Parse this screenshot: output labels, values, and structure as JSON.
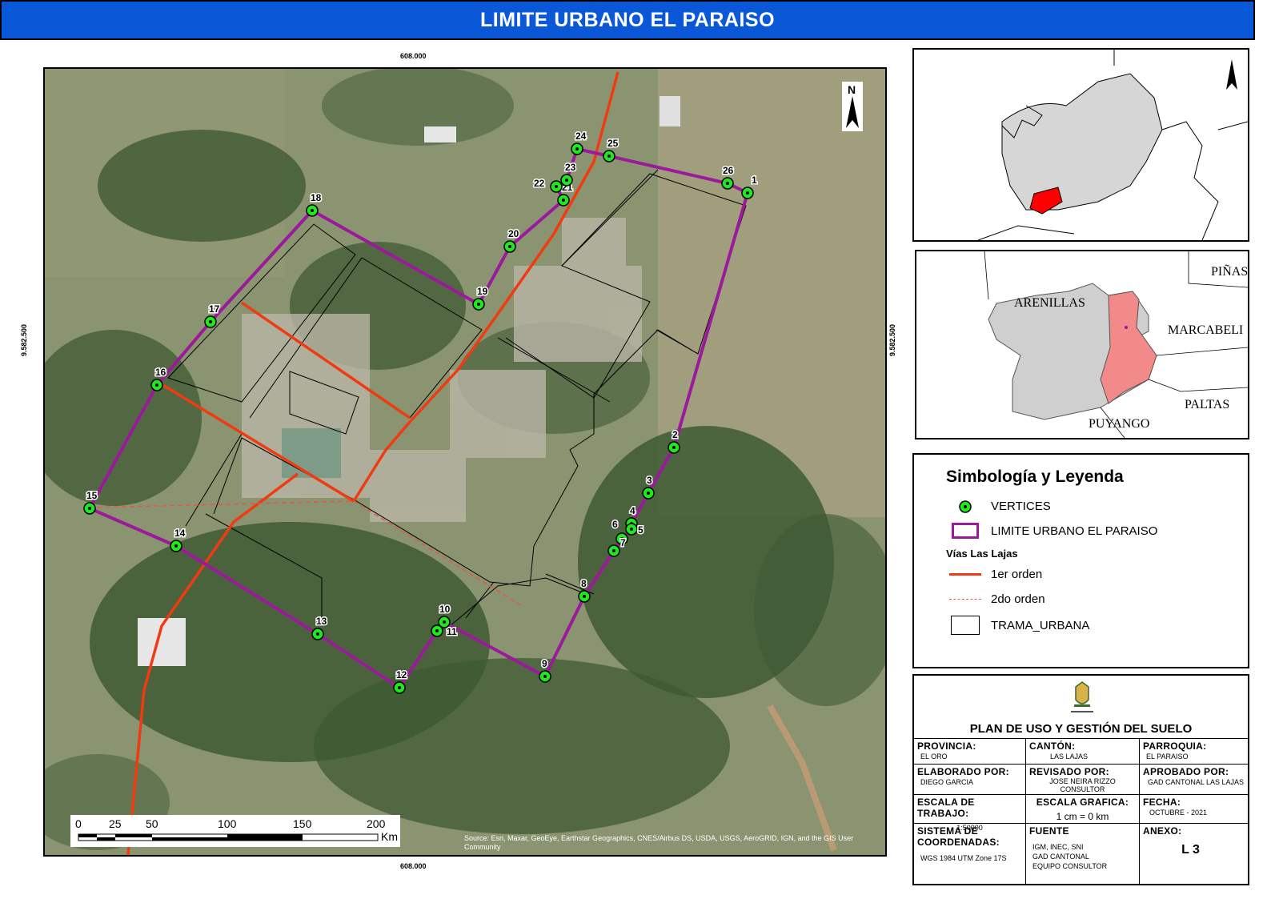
{
  "title": "LIMITE URBANO EL PARAISO",
  "coords": {
    "x_top": "608.000",
    "x_bottom": "608.000",
    "y_left": "9.582.500",
    "y_right": "9.582.500"
  },
  "north_label": "N",
  "vertices": [
    "1",
    "2",
    "3",
    "4",
    "5",
    "6",
    "7",
    "8",
    "9",
    "10",
    "11",
    "12",
    "13",
    "14",
    "15",
    "16",
    "17",
    "18",
    "19",
    "20",
    "21",
    "22",
    "23",
    "24",
    "25",
    "26"
  ],
  "scalebar": {
    "ticks": [
      "0",
      "25",
      "50",
      "100",
      "150",
      "200"
    ],
    "unit": "Km"
  },
  "attribution": "Source: Esri, Maxar, GeoEye, Earthstar Geographics, CNES/Airbus DS, USDA, USGS, AeroGRID, IGN, and the GIS User Community",
  "locator2": {
    "labels": [
      "ARENILLAS",
      "PIÑAS",
      "MARCABELI",
      "PALTAS",
      "PUYANGO"
    ]
  },
  "legend": {
    "title": "Simbología y Leyenda",
    "vertices": "VERTICES",
    "limit": "LIMITE URBANO EL PARAISO",
    "roads_heading": "Vías Las Lajas",
    "road1": "1er orden",
    "road2": "2do orden",
    "grid": "TRAMA_URBANA"
  },
  "colors": {
    "title_bar": "#0a57d8",
    "limit": "#9b1a9b",
    "road1": "#f03b12",
    "vertex": "#1ee81e",
    "highlight": "#f28a8a",
    "red_parish": "#ff0000"
  },
  "info": {
    "plan_title": "PLAN DE USO Y GESTIÓN DEL SUELO",
    "provincia_label": "PROVINCIA:",
    "provincia": "EL ORO",
    "canton_label": "CANTÓN:",
    "canton": "LAS LAJAS",
    "parroquia_label": "PARROQUIA:",
    "parroquia": "EL PARAISO",
    "elaborado_label": "ELABORADO POR:",
    "elaborado": "DIEGO GARCIA",
    "revisado_label": "REVISADO POR:",
    "revisado1": "JOSE NEIRA RIZZO",
    "revisado2": "CONSULTOR",
    "aprobado_label": "APROBADO POR:",
    "aprobado": "GAD CANTONAL LAS LAJAS",
    "escala_trabajo_label": "ESCALA DE TRABAJO:",
    "escala_trabajo": "1:50000",
    "escala_grafica_label": "ESCALA GRAFICA:",
    "escala_grafica": "1 cm = 0 km",
    "fecha_label": "FECHA:",
    "fecha": "OCTUBRE - 2021",
    "sistema_label": "SISTEMA DE COORDENADAS:",
    "sistema": "WGS 1984 UTM Zone 17S",
    "fuente_label": "FUENTE",
    "fuente1": "IGM, INEC, SNI",
    "fuente2": "GAD CANTONAL",
    "fuente3": "EQUIPO CONSULTOR",
    "anexo_label": "ANEXO:",
    "anexo": "L 3"
  }
}
